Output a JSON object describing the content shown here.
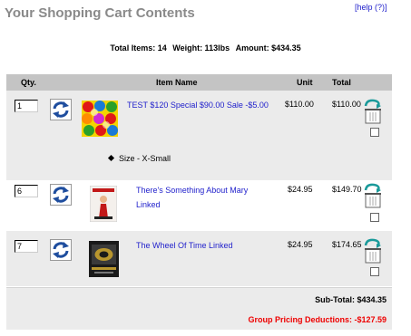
{
  "page": {
    "title": "Your Shopping Cart Contents",
    "help_link": "[help (?)]"
  },
  "summary": {
    "total_items": "Total Items: 14",
    "weight": "Weight: 113lbs",
    "amount": "Amount: $434.35"
  },
  "table": {
    "headers": {
      "qty": "Qty.",
      "name": "Item Name",
      "unit": "Unit",
      "total": "Total"
    },
    "rows": [
      {
        "qty": "1",
        "name": "TEST $120 Special $90.00 Sale -$5.00",
        "unit": "$110.00",
        "total": "$110.00",
        "attribute": "Size - X-Small",
        "thumbnail": "colorful-buttons-image"
      },
      {
        "qty": "6",
        "name": "There's Something About Mary Linked",
        "unit": "$24.95",
        "total": "$149.70",
        "thumbnail": "movie-poster-image"
      },
      {
        "qty": "7",
        "name": "The Wheel Of Time Linked",
        "unit": "$24.95",
        "total": "$174.65",
        "thumbnail": "box-set-image"
      }
    ]
  },
  "totals": {
    "subtotal": "Sub-Total: $434.35",
    "group_deduction": "Group Pricing Deductions: -$127.59"
  },
  "icons": {
    "update": "refresh-arrows-icon",
    "remove": "trash-can-icon"
  },
  "colors": {
    "link": "#2222cc",
    "deduction": "#ee0000",
    "header_bg": "#c4c4c4",
    "row_alt_bg": "#ebebeb",
    "update_icon": "#1e4d9e"
  }
}
